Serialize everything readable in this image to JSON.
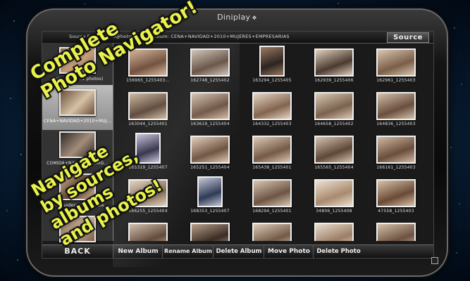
{
  "device": {
    "brand": "Diniplay",
    "brand_mark": "❖"
  },
  "header": {
    "source_text": "Source  E... castano@hotmail.com  Album: CENA+NAVIDAD+2010+MUJERES+EMPRESARIAS",
    "source_button": "Source"
  },
  "albums": [
    {
      "label": "WallsPhotos (1 photos)",
      "selected": false,
      "colors": [
        "#8a6b52",
        "#c9a27f"
      ]
    },
    {
      "label": "CENA+NAVIDAD+2010+MUJ...",
      "selected": true,
      "colors": [
        "#6b4e3a",
        "#d6c2a5"
      ]
    },
    {
      "label": "COMIDA+NAVIDAD+AMIG...",
      "selected": false,
      "colors": [
        "#2e2a26",
        "#a38c7a"
      ]
    },
    {
      "label": "Unadaadesvinodelspaie",
      "selected": false,
      "colors": [
        "#d0b69a",
        "#5a3b2c"
      ]
    },
    {
      "label": "",
      "selected": false,
      "colors": [
        "#7a5a45",
        "#c8b39e"
      ]
    }
  ],
  "photos": [
    {
      "caption": "156965_1255403...",
      "colors": [
        "#6e4c3a",
        "#d7b89a"
      ]
    },
    {
      "caption": "162748_1255402",
      "colors": [
        "#5f4a3b",
        "#cfc3b5"
      ]
    },
    {
      "caption": "163294_1255405",
      "colors": [
        "#2c2420",
        "#9a7a62"
      ]
    },
    {
      "caption": "162939_1255406",
      "colors": [
        "#4a3a30",
        "#e0cfbd"
      ]
    },
    {
      "caption": "162961_1255403",
      "colors": [
        "#7a5e48",
        "#d9c6b2"
      ]
    },
    {
      "caption": "163044_1255401",
      "colors": [
        "#5a4536",
        "#cdb8a1"
      ]
    },
    {
      "caption": "163619_1255404",
      "colors": [
        "#6b5040",
        "#d2bea9"
      ]
    },
    {
      "caption": "164332_1255403",
      "colors": [
        "#83654f",
        "#e4d5c4"
      ]
    },
    {
      "caption": "164658_1255402",
      "colors": [
        "#7a624e",
        "#dac9b6"
      ]
    },
    {
      "caption": "164836_1255403",
      "colors": [
        "#6a4f3d",
        "#d3c0ad"
      ]
    },
    {
      "caption": "165319_1255407",
      "colors": [
        "#2a2a44",
        "#c8c2d8"
      ]
    },
    {
      "caption": "165251_1255404",
      "colors": [
        "#6d5240",
        "#e0cbb4"
      ]
    },
    {
      "caption": "165438_1255401",
      "colors": [
        "#745a47",
        "#dccab6"
      ]
    },
    {
      "caption": "165565_1255404",
      "colors": [
        "#5e4737",
        "#d6c4b1"
      ]
    },
    {
      "caption": "166161_1255403",
      "colors": [
        "#6a4e3b",
        "#cfbaa4"
      ]
    },
    {
      "caption": "166255_1255404",
      "colors": [
        "#7d6450",
        "#e2d2bf"
      ]
    },
    {
      "caption": "168353_1255407",
      "colors": [
        "#2f3a55",
        "#c4c8d8"
      ]
    },
    {
      "caption": "168294_1255401",
      "colors": [
        "#6e5543",
        "#d8c6b3"
      ]
    },
    {
      "caption": "34806_1255408",
      "colors": [
        "#a88a6f",
        "#ede0d0"
      ]
    },
    {
      "caption": "47558_1255403",
      "colors": [
        "#6a4a36",
        "#d9c2a8"
      ]
    },
    {
      "caption": "",
      "colors": [
        "#5e4636",
        "#cdb9a5"
      ]
    },
    {
      "caption": "",
      "colors": [
        "#3a2c24",
        "#b89e88"
      ]
    },
    {
      "caption": "",
      "colors": [
        "#735a47",
        "#dccbb8"
      ]
    },
    {
      "caption": "",
      "colors": [
        "#9b7e66",
        "#e8dccd"
      ]
    },
    {
      "caption": "",
      "colors": [
        "#6d5240",
        "#d4c0ab"
      ]
    }
  ],
  "footer": {
    "back": "BACK",
    "new_album": "New Album",
    "rename_album": "Rename Album",
    "delete_album": "Delete Album",
    "move_photo": "Move Photo",
    "delete_photo": "Delete Photo"
  },
  "promo": {
    "line1": "Complete",
    "line2": "Photo Navigator!",
    "line3": "Navigate",
    "line4": "by sources,",
    "line5": "albums",
    "line6": "and photos!"
  }
}
